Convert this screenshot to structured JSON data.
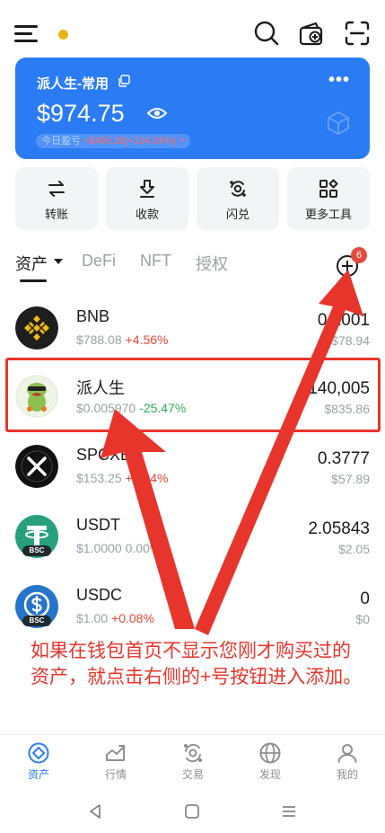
{
  "wallet": {
    "name": "派人生-常用",
    "more": "•••",
    "balance": "$974.75",
    "pnl_label": "今日盈亏",
    "pnl_value": "+$495.38(+104.08%) >"
  },
  "actions": [
    {
      "label": "转账",
      "icon": "transfer-icon"
    },
    {
      "label": "收款",
      "icon": "receive-icon"
    },
    {
      "label": "闪兑",
      "icon": "swap-icon"
    },
    {
      "label": "更多工具",
      "icon": "tools-icon"
    }
  ],
  "tabs": [
    {
      "label": "资产",
      "active": true
    },
    {
      "label": "DeFi",
      "active": false
    },
    {
      "label": "NFT",
      "active": false
    },
    {
      "label": "授权",
      "active": false
    }
  ],
  "add_badge": "6",
  "assets": [
    {
      "name": "BNB",
      "price": "$788.08",
      "change": "+4.56%",
      "direction": "up",
      "amount": "0.1001",
      "value": "$78.94",
      "icon": "bnb-icon",
      "color": "#1e1e1e"
    },
    {
      "name": "派人生",
      "price": "$0.005970",
      "change": "-25.47%",
      "direction": "down",
      "amount": "140,005",
      "value": "$835.86",
      "icon": "frog-mascot-icon",
      "color": "#eef4e6"
    },
    {
      "name": "SPCXB",
      "price": "$153.25",
      "change": "+0.04%",
      "direction": "up",
      "amount": "0.3777",
      "value": "$57.89",
      "icon": "spacex-x-icon",
      "color": "#111111"
    },
    {
      "name": "USDT",
      "price": "$1.0000",
      "change": "0.00%",
      "direction": "flat",
      "amount": "2.05843",
      "value": "$2.05",
      "icon": "tether-icon",
      "color": "#26a17b",
      "tag": "BSC"
    },
    {
      "name": "USDC",
      "price": "$1.00",
      "change": "+0.08%",
      "direction": "up",
      "amount": "0",
      "value": "$0",
      "icon": "usdc-icon",
      "color": "#2775ca",
      "tag": "BSC"
    }
  ],
  "annotation": "如果在钱包首页不显示您刚才购买过的资产，就点击右侧的+号按钮进入添加。",
  "tabbar": [
    {
      "label": "资产",
      "icon": "assets-icon",
      "active": true
    },
    {
      "label": "行情",
      "icon": "market-icon",
      "active": false
    },
    {
      "label": "交易",
      "icon": "trade-icon",
      "active": false
    },
    {
      "label": "发现",
      "icon": "discover-icon",
      "active": false
    },
    {
      "label": "我的",
      "icon": "profile-icon",
      "active": false
    }
  ],
  "colors": {
    "accent": "#2b7cf4",
    "up": "#e8483a",
    "down": "#2bae5a",
    "annotation": "#e8352c"
  }
}
